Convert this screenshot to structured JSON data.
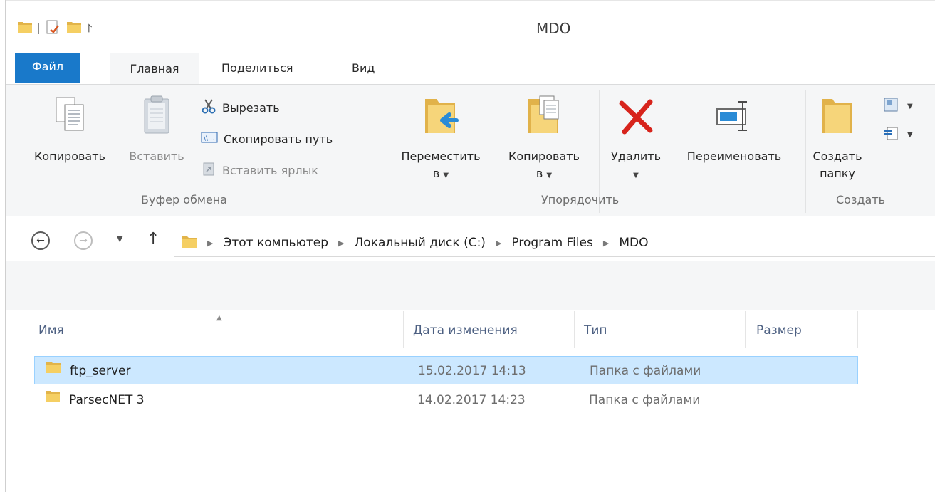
{
  "window": {
    "title": "MDO"
  },
  "tabs": [
    {
      "label": "Файл"
    },
    {
      "label": "Главная"
    },
    {
      "label": "Поделиться"
    },
    {
      "label": "Вид"
    }
  ],
  "ribbon": {
    "clipboard": {
      "copy": "Копировать",
      "paste": "Вставить",
      "cut": "Вырезать",
      "copy_path": "Скопировать путь",
      "paste_shortcut": "Вставить ярлык",
      "group_label": "Буфер обмена"
    },
    "organize": {
      "move_to_line1": "Переместить",
      "move_to_line2": "в",
      "copy_to_line1": "Копировать",
      "copy_to_line2": "в",
      "delete": "Удалить",
      "rename": "Переименовать",
      "group_label": "Упорядочить"
    },
    "create": {
      "new_folder_line1": "Создать",
      "new_folder_line2": "папку",
      "group_label": "Создать"
    }
  },
  "address": {
    "crumbs": [
      "Этот компьютер",
      "Локальный диск (C:)",
      "Program Files",
      "MDO"
    ]
  },
  "columns": {
    "name": "Имя",
    "date": "Дата изменения",
    "type": "Тип",
    "size": "Размер"
  },
  "files": [
    {
      "name": "ftp_server",
      "date": "15.02.2017 14:13",
      "type": "Папка с файлами",
      "selected": true
    },
    {
      "name": "ParsecNET 3",
      "date": "14.02.2017 14:23",
      "type": "Папка с файлами",
      "selected": false
    }
  ],
  "colors": {
    "file_tab": "#1979ca",
    "selection_bg": "#cce8ff",
    "selection_border": "#99d1ff",
    "folder_yellow": "#f2c94c",
    "delete_red": "#d7241c"
  }
}
